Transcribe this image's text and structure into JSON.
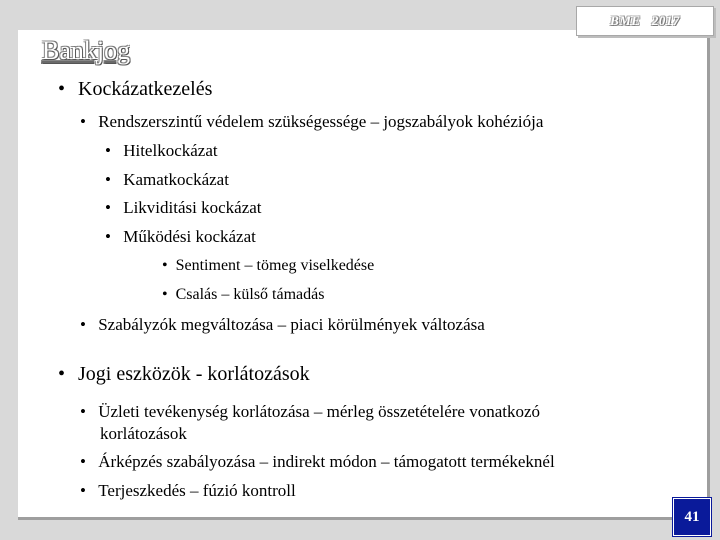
{
  "header": {
    "text": "BME   2017"
  },
  "title": "Bankjog",
  "section1": {
    "heading": "Kockázatkezelés",
    "items": [
      "Rendszerszintű védelem szükségessége – jogszabályok kohéziója",
      "Hitelkockázat",
      "Kamatkockázat",
      "Likviditási kockázat",
      "Működési kockázat",
      "Sentiment – tömeg viselkedése",
      "Csalás – külső támadás",
      "Szabályzók megváltozása – piaci körülmények változása"
    ]
  },
  "section2": {
    "heading": "Jogi eszközök - korlátozások",
    "items": [
      "Üzleti tevékenység korlátozása – mérleg összetételére vonatkozó",
      "korlátozások",
      "Árképzés szabályozása – indirekt módon – támogatott termékeknél",
      "Terjeszkedés – fúzió kontroll"
    ]
  },
  "bullet": "•",
  "page_number": "41"
}
